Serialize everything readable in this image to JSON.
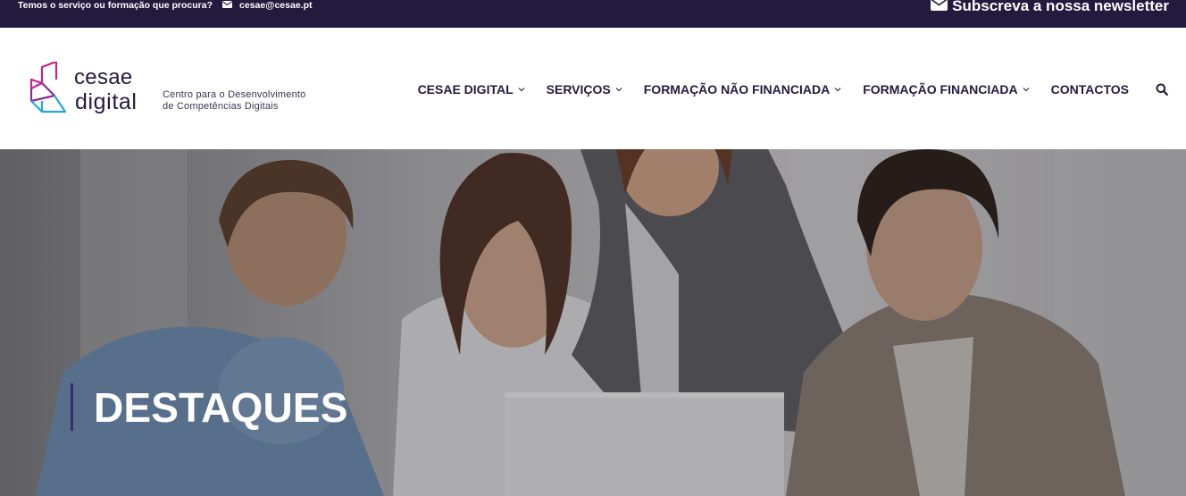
{
  "topbar": {
    "tagline": "Temos o serviço ou formação que procura?",
    "email": "cesae@cesae.pt",
    "newsletter": "Subscreva a nossa newsletter",
    "background": "#241a3e"
  },
  "logo": {
    "word1": "cesae",
    "word2": "digital",
    "tagline_line1": "Centro para o Desenvolvimento",
    "tagline_line2": "de Competências Digitais",
    "colors": {
      "magenta": "#c0258a",
      "cyan": "#2aa7d8",
      "navy": "#241a3e"
    }
  },
  "nav": {
    "items": [
      {
        "label": "CESAE DIGITAL",
        "has_dropdown": true
      },
      {
        "label": "SERVIÇOS",
        "has_dropdown": true
      },
      {
        "label": "FORMAÇÃO NÃO FINANCIADA",
        "has_dropdown": true
      },
      {
        "label": "FORMAÇÃO FINANCIADA",
        "has_dropdown": true
      },
      {
        "label": "CONTACTOS",
        "has_dropdown": false
      }
    ],
    "search_icon": "search-icon"
  },
  "hero": {
    "title": "DESTAQUES",
    "accent": "#3b2a6b"
  }
}
